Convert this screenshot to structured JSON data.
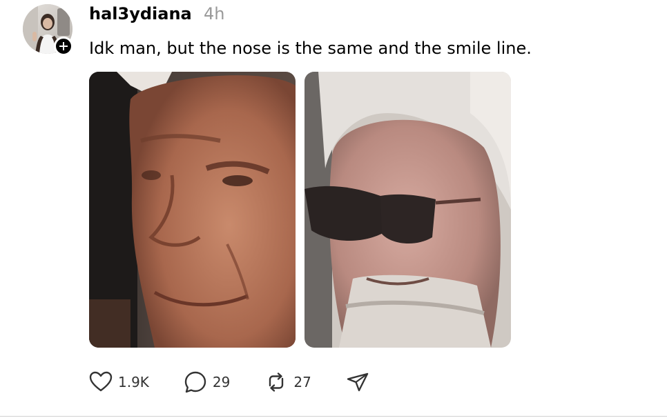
{
  "post": {
    "username": "hal3ydiana",
    "timestamp": "4h",
    "text": "Idk man, but the nose is the same and the smile line.",
    "avatar_icon": "profile-photo",
    "follow_icon": "plus-icon",
    "media": [
      {
        "icon": "photo-man-face-closeup"
      },
      {
        "icon": "photo-bearded-man-sunglasses"
      }
    ]
  },
  "actions": {
    "like_count": "1.9K",
    "reply_count": "29",
    "repost_count": "27",
    "icons": [
      "heart-icon",
      "comment-icon",
      "repost-icon",
      "share-icon"
    ]
  },
  "colors": {
    "text": "#000000",
    "timestamp": "#999999",
    "count": "#333333",
    "divider": "#d0d0d0"
  }
}
